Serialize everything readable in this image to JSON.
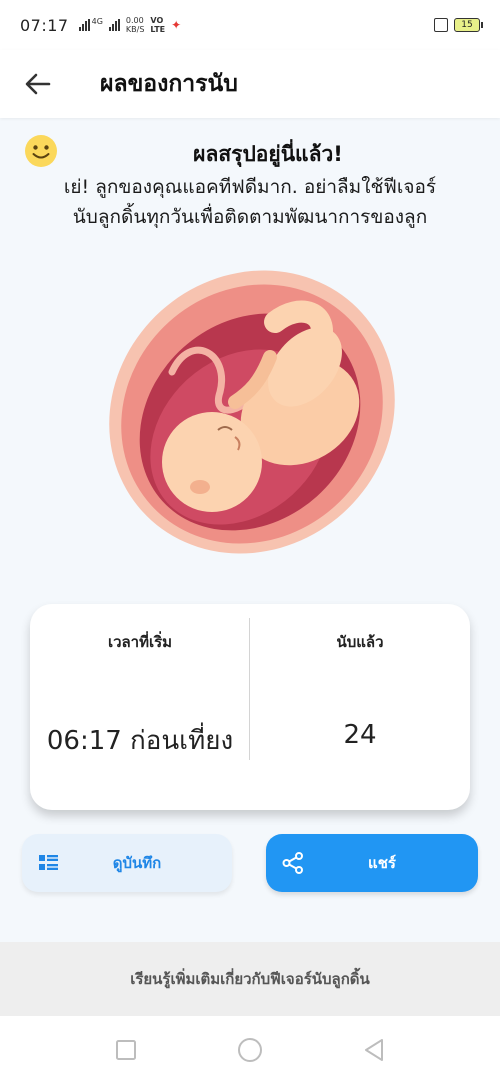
{
  "status": {
    "time": "07:17",
    "network_label": "4G",
    "speed_value": "0.00",
    "speed_unit": "KB/S",
    "volte_top": "VO",
    "volte_bottom": "LTE",
    "battery": "15"
  },
  "header": {
    "title": "ผลของการนับ",
    "back_icon": "arrow-left-icon"
  },
  "summary": {
    "icon": "smiley-face-icon",
    "title": "ผลสรุปอยู่นี่แล้ว!",
    "line1": "เย่! ลูกของคุณแอคทีฟดีมาก. อย่าลืมใช้ฟีเจอร์",
    "line2": "นับลูกดิ้นทุกวันเพื่อติดตามพัฒนาการของลูก"
  },
  "stats": {
    "start_label": "เวลาที่เริ่ม",
    "start_value": "06:17 ก่อนเที่ยง",
    "count_label": "นับแล้ว",
    "count_value": "24"
  },
  "actions": {
    "history_label": "ดูบันทึก",
    "history_icon": "list-icon",
    "share_label": "แชร์",
    "share_icon": "share-icon"
  },
  "learn_more": "เรียนรู้เพิ่มเติมเกี่ยวกับฟีเจอร์นับลูกดิ้น",
  "nav": {
    "recents_icon": "square-icon",
    "home_icon": "circle-icon",
    "back_icon": "triangle-back-icon"
  },
  "colors": {
    "accent": "#2196f3",
    "accent_light": "#e7f1fb",
    "background": "#f4f8fc"
  }
}
